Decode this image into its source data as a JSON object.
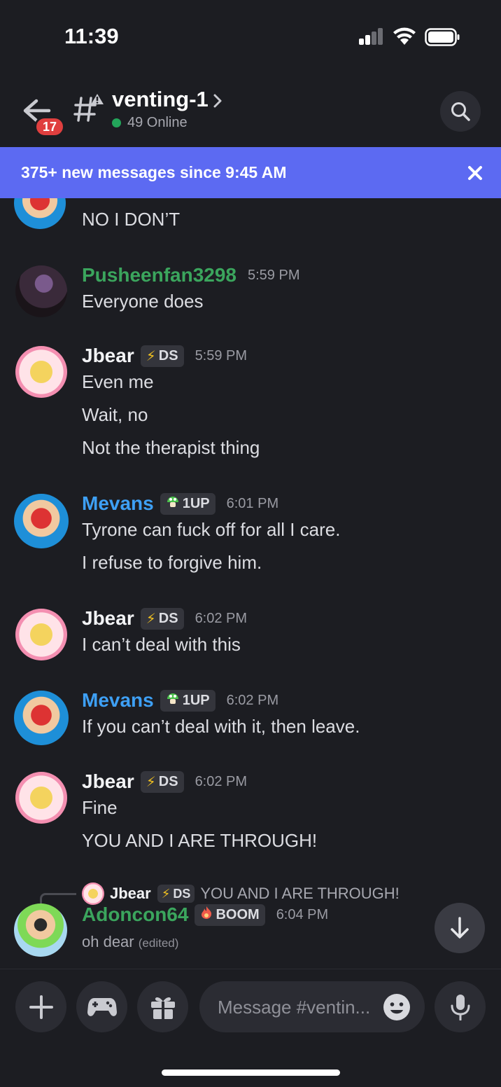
{
  "status_bar": {
    "time": "11:39"
  },
  "header": {
    "back_badge": "17",
    "channel_name": "venting-1",
    "online": "49 Online"
  },
  "banner": {
    "text": "375+ new messages since 9:45 AM"
  },
  "colors": {
    "accent": "#5c6af2",
    "green_user": "#3ba55d",
    "blue_user": "#3ea0f5",
    "white_user": "#f2f3f5"
  },
  "messages": {
    "m0": {
      "lines": [
        "NO I DON’T"
      ]
    },
    "m1": {
      "author": "Pusheenfan3298",
      "time": "5:59 PM",
      "lines": [
        "Everyone does"
      ]
    },
    "m2": {
      "author": "Jbear",
      "tag": "DS",
      "tag_icon": "lightning-icon",
      "time": "5:59 PM",
      "lines": [
        "Even me",
        "Wait, no",
        "Not the therapist thing"
      ]
    },
    "m3": {
      "author": "Mevans",
      "tag": "1UP",
      "tag_icon": "mushroom-icon",
      "time": "6:01 PM",
      "lines": [
        "Tyrone can fuck off for all I care.",
        "I refuse to forgive him."
      ]
    },
    "m4": {
      "author": "Jbear",
      "tag": "DS",
      "tag_icon": "lightning-icon",
      "time": "6:02 PM",
      "lines": [
        "I can’t deal with this"
      ]
    },
    "m5": {
      "author": "Mevans",
      "tag": "1UP",
      "tag_icon": "mushroom-icon",
      "time": "6:02 PM",
      "lines": [
        "If you can’t deal with it, then leave."
      ]
    },
    "m6": {
      "author": "Jbear",
      "tag": "DS",
      "tag_icon": "lightning-icon",
      "time": "6:02 PM",
      "lines": [
        "Fine",
        "YOU AND I ARE THROUGH!"
      ]
    },
    "m7": {
      "reply": {
        "author": "Jbear",
        "tag": "DS",
        "tag_icon": "lightning-icon",
        "text": "YOU AND I ARE THROUGH!"
      },
      "author": "Adoncon64",
      "tag": "BOOM",
      "tag_icon": "explosion-icon",
      "time": "6:04 PM",
      "lines": [
        "oh dear"
      ],
      "edited": "(edited)"
    }
  },
  "composer": {
    "placeholder": "Message #ventin..."
  }
}
